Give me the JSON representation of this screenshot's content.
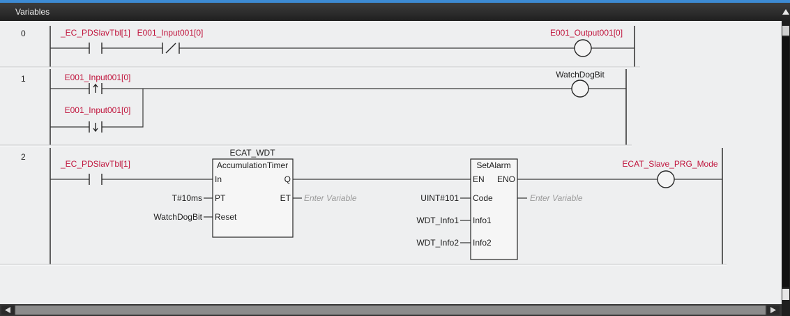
{
  "panel": {
    "title": "Variables",
    "collapse_icon": "triangle-up-icon"
  },
  "rungs": [
    {
      "number": "0",
      "contacts": [
        {
          "variable": "_EC_PDSlavTbl[1]",
          "icon": "normally-open-contact-icon"
        },
        {
          "variable": "E001_Input001[0]",
          "icon": "normally-closed-contact-icon"
        }
      ],
      "coil": {
        "variable": "E001_Output001[0]",
        "icon": "coil-icon"
      }
    },
    {
      "number": "1",
      "contacts": [
        {
          "variable": "E001_Input001[0]",
          "icon": "rising-edge-contact-icon"
        },
        {
          "variable": "E001_Input001[0]",
          "icon": "falling-edge-contact-icon"
        }
      ],
      "coil": {
        "variable": "WatchDogBit",
        "icon": "coil-icon"
      }
    },
    {
      "number": "2",
      "contacts": [
        {
          "variable": "_EC_PDSlavTbl[1]",
          "icon": "normally-open-contact-icon"
        }
      ],
      "timer_block": {
        "instance": "ECAT_WDT",
        "type": "AccumulationTimer",
        "pins": {
          "in": "In",
          "q": "Q",
          "pt": "PT",
          "et": "ET",
          "reset": "Reset"
        },
        "pt_value": "T#10ms",
        "reset_value": "WatchDogBit",
        "et_placeholder": "Enter Variable"
      },
      "alarm_block": {
        "type": "SetAlarm",
        "pins": {
          "en": "EN",
          "eno": "ENO",
          "code": "Code",
          "info1": "Info1",
          "info2": "Info2"
        },
        "code_value": "UINT#101",
        "info1_value": "WDT_Info1",
        "info2_value": "WDT_Info2",
        "output_placeholder": "Enter Variable"
      },
      "coil": {
        "variable": "ECAT_Slave_PRG_Mode",
        "icon": "coil-icon"
      }
    }
  ],
  "scrollbars": {
    "vertical_up_icon": "arrow-up-icon",
    "horizontal_left_icon": "arrow-left-icon",
    "horizontal_right_icon": "arrow-right-icon"
  },
  "colors": {
    "red_variable_text": "#c0143c",
    "defined_variable_text": "#1e1e1e",
    "placeholder_text": "#9a9a9a",
    "header_background": "#2b2b2b",
    "header_accent": "#3d8bd4",
    "canvas_background": "#eeeff0"
  }
}
